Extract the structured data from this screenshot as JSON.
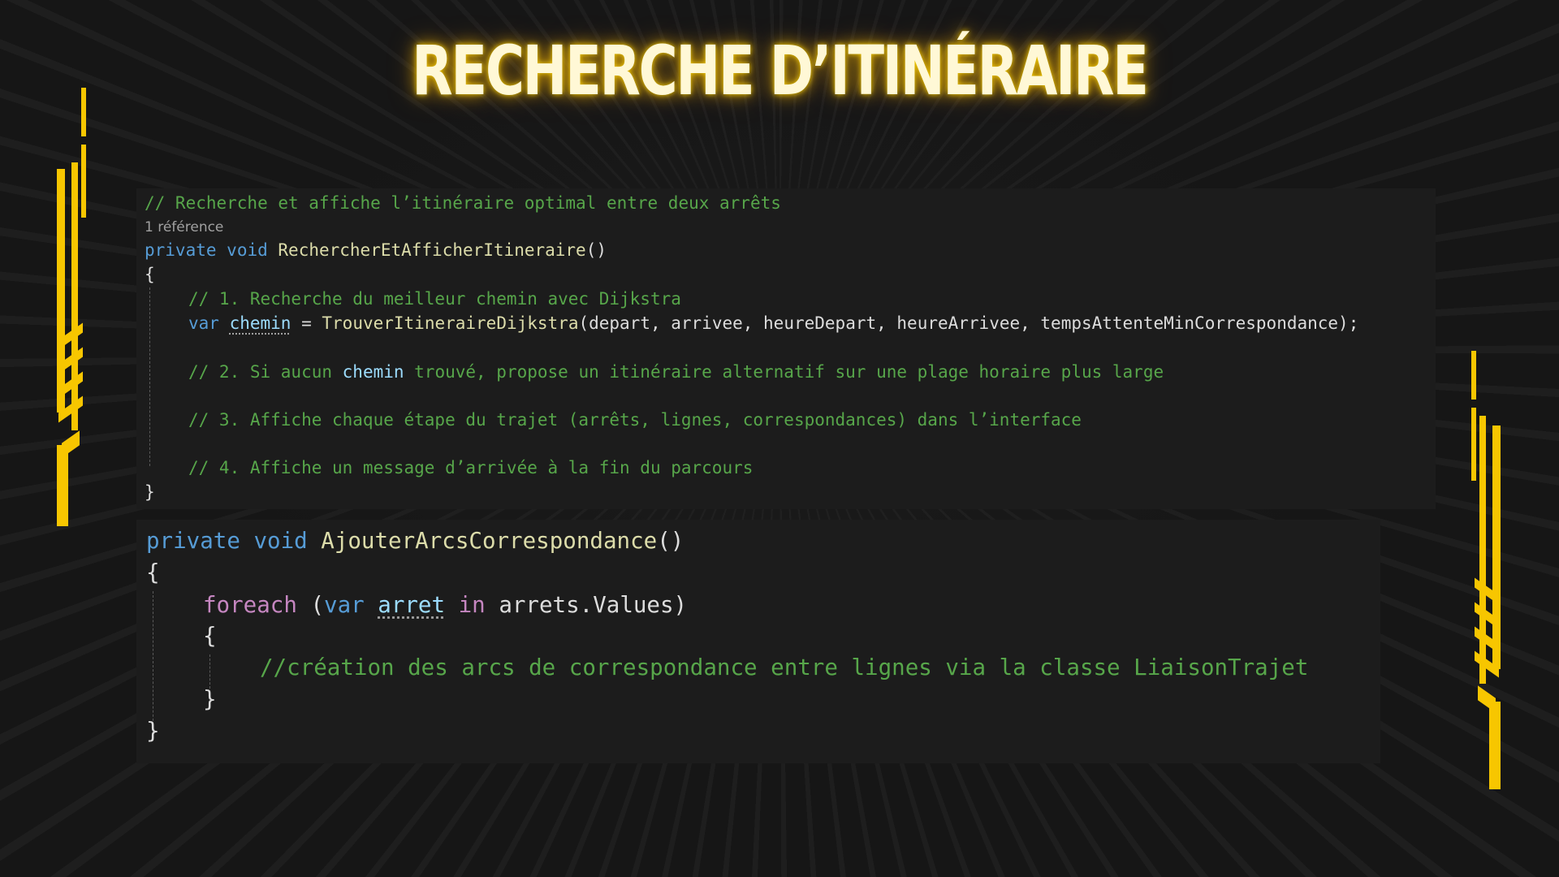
{
  "title": "RECHERCHE D’ITINÉRAIRE",
  "accent_color": "#f7c600",
  "snippet1": {
    "comment_header": "// Recherche et affiche l’itinéraire optimal entre deux arrêts",
    "reference": "1 référence",
    "kw_private": "private",
    "kw_void": "void",
    "method_name": "RechercherEtAfficherItineraire",
    "parens": "()",
    "open_brace": "{",
    "step1": "// 1. Recherche du meilleur chemin avec Dijkstra",
    "kw_var": "var",
    "var_chemin": "chemin",
    "assign": " = ",
    "call_name": "TrouverItineraireDijkstra",
    "call_args": "(depart, arrivee, heureDepart, heureArrivee, tempsAttenteMinCorrespondance);",
    "step2_a": "// 2. Si aucun ",
    "step2_b": "chemin",
    "step2_c": " trouvé, propose un itinéraire alternatif sur une plage horaire plus large",
    "step3": "// 3. Affiche chaque étape du trajet (arrêts, lignes, correspondances) dans l’interface",
    "step4": "// 4. Affiche un message d’arrivée à la fin du parcours",
    "close_brace": "}"
  },
  "snippet2": {
    "kw_private": "private",
    "kw_void": "void",
    "method_name": "AjouterArcsCorrespondance",
    "parens": "()",
    "open_brace": "{",
    "kw_foreach": "foreach",
    "lparen": " (",
    "kw_var": "var",
    "var_arret": "arret",
    "kw_in": "in",
    "collection": "arrets.Values",
    "rparen": ")",
    "inner_open": "{",
    "comment": "//création des arcs de correspondance entre lignes via la classe LiaisonTrajet",
    "inner_close": "}",
    "close_brace": "}"
  }
}
